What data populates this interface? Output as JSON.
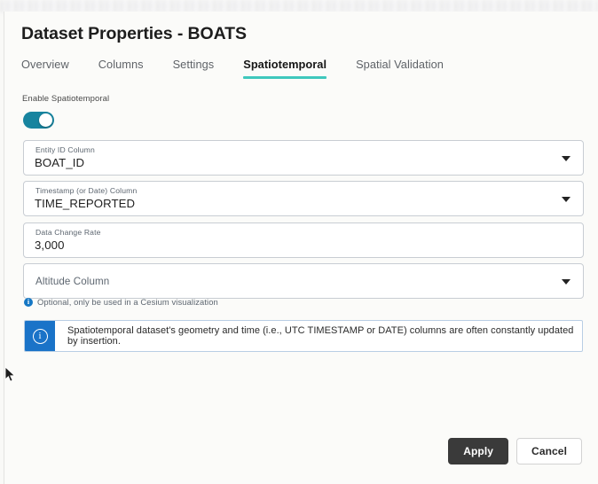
{
  "window": {
    "title": "Dataset Properties - BOATS"
  },
  "tabs": [
    {
      "label": "Overview",
      "active": false
    },
    {
      "label": "Columns",
      "active": false
    },
    {
      "label": "Settings",
      "active": false
    },
    {
      "label": "Spatiotemporal",
      "active": true
    },
    {
      "label": "Spatial Validation",
      "active": false
    }
  ],
  "enable_toggle": {
    "label": "Enable Spatiotemporal",
    "state": "on"
  },
  "fields": {
    "entity": {
      "label": "Entity ID Column",
      "value": "BOAT_ID",
      "type": "select"
    },
    "timestamp": {
      "label": "Timestamp (or Date) Column",
      "value": "TIME_REPORTED",
      "type": "select"
    },
    "rate": {
      "label": "Data Change Rate",
      "value": "3,000",
      "type": "text"
    },
    "altitude": {
      "label": "Altitude Column",
      "placeholder": "Altitude Column",
      "value": "",
      "type": "select",
      "help": "Optional, only be used in a Cesium visualization"
    }
  },
  "info_banner": {
    "icon": "info-icon",
    "text": "Spatiotemporal dataset's geometry and time (i.e., UTC TIMESTAMP or DATE) columns are often constantly updated by insertion."
  },
  "actions": {
    "apply_label": "Apply",
    "cancel_label": "Cancel"
  },
  "colors": {
    "accent_underline": "#3fc8bd",
    "toggle_on": "#17849f",
    "info_blue": "#1a73c8",
    "apply_dark": "#3a3a3a"
  },
  "glyphs": {
    "chevron_down": "▼",
    "info": "i"
  }
}
